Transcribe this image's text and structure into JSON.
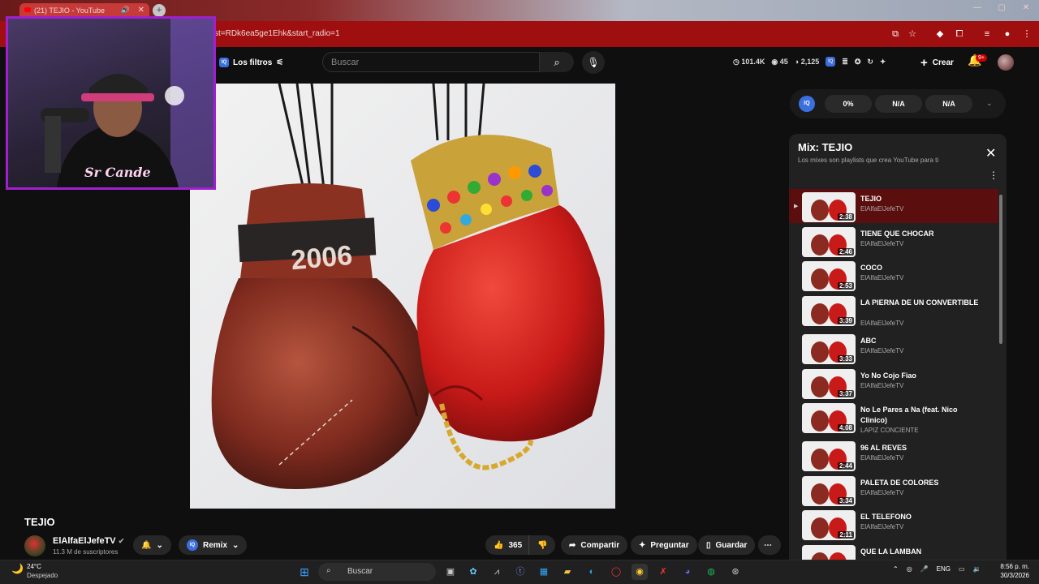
{
  "browser": {
    "tab_title": "(21) TEJIO - YouTube",
    "url": "st=RDk6ea5ge1Ehk&start_radio=1"
  },
  "header": {
    "filters_label": "Los filtros",
    "search_placeholder": "Buscar",
    "stats": {
      "views": "101.4K",
      "eyes": "45",
      "likes": "2,125"
    },
    "create_label": "Crear",
    "notif_badge": "9+"
  },
  "iq_bar": {
    "pill1": "0%",
    "pill2": "N/A",
    "pill3": "N/A"
  },
  "webcam": {
    "overlay_text": "Sr Cande"
  },
  "artwork": {
    "glove_text": "2006"
  },
  "playlist": {
    "title": "Mix: TEJIO",
    "subtitle": "Los mixes son playlists que crea YouTube para ti",
    "items": [
      {
        "title": "TEJIO",
        "channel": "ElAlfaElJefeTV",
        "duration": "2:38",
        "active": true
      },
      {
        "title": "TIENE QUE CHOCAR",
        "channel": "ElAlfaElJefeTV",
        "duration": "2:46"
      },
      {
        "title": "COCO",
        "channel": "ElAlfaElJefeTV",
        "duration": "2:53"
      },
      {
        "title": "LA PIERNA DE UN CONVERTIBLE",
        "channel": "ElAlfaElJefeTV",
        "duration": "3:39"
      },
      {
        "title": "ABC",
        "channel": "ElAlfaElJefeTV",
        "duration": "3:33"
      },
      {
        "title": "Yo No Cojo Fiao",
        "channel": "ElAlfaElJefeTV",
        "duration": "3:37"
      },
      {
        "title": "No Le Pares a Na (feat. Nico Clinico)",
        "channel": "LAPIZ CONCIENTE",
        "duration": "4:08"
      },
      {
        "title": "96 AL REVES",
        "channel": "ElAlfaElJefeTV",
        "duration": "2:44"
      },
      {
        "title": "PALETA DE COLORES",
        "channel": "ElAlfaElJefeTV",
        "duration": "3:34"
      },
      {
        "title": "EL TELEFONO",
        "channel": "ElAlfaElJefeTV",
        "duration": "2:11"
      },
      {
        "title": "QUE LA LAMBAN",
        "channel": "",
        "duration": ""
      }
    ]
  },
  "video": {
    "title": "TEJIO",
    "channel": "ElAlfaElJefeTV",
    "subscribers": "11.3 M de suscriptores",
    "remix_label": "Remix",
    "likes": "365",
    "share_label": "Compartir",
    "ask_label": "Preguntar",
    "save_label": "Guardar"
  },
  "taskbar": {
    "temp": "24°C",
    "weather": "Despejado",
    "search_label": "Buscar",
    "lang": "ENG",
    "time": "8:56 p. m.",
    "date": "30/3/2026"
  }
}
